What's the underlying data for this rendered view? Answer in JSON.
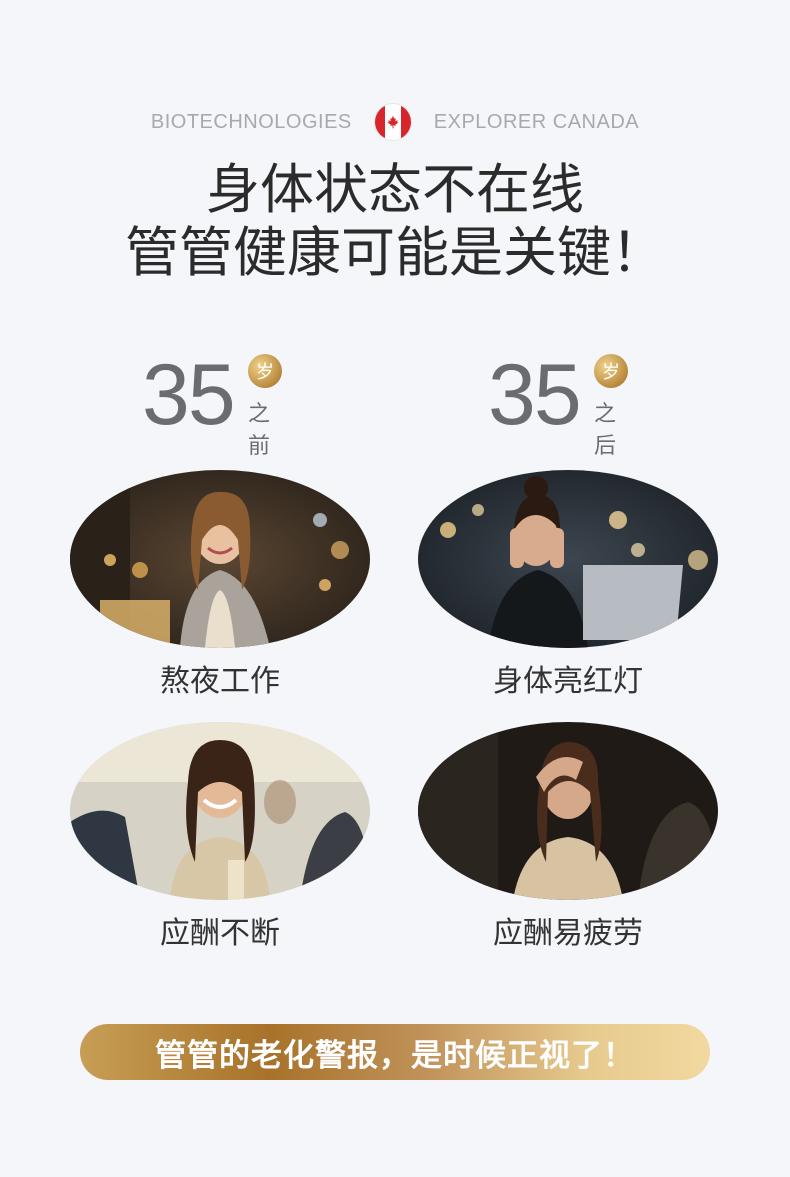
{
  "brand": {
    "left": "BIOTECHNOLOGIES",
    "right": "EXPLORER CANADA",
    "flag_icon": "canada-flag-icon"
  },
  "headline": {
    "line1": "身体状态不在线",
    "line2": "管管健康可能是关键！"
  },
  "ages": [
    {
      "number": "35",
      "badge": "岁",
      "suffix": "之前"
    },
    {
      "number": "35",
      "badge": "岁",
      "suffix": "之后"
    }
  ],
  "cards": [
    {
      "caption": "熬夜工作"
    },
    {
      "caption": "身体亮红灯"
    },
    {
      "caption": "应酬不断"
    },
    {
      "caption": "应酬易疲劳"
    }
  ],
  "banner": {
    "text": "管管的老化警报，是时候正视了！"
  },
  "colors": {
    "background": "#f4f6f9",
    "gold": "#b98a3d",
    "text_dark": "#2b2b2b",
    "text_gray": "#6b6c6f",
    "flag_red": "#d9262c"
  }
}
